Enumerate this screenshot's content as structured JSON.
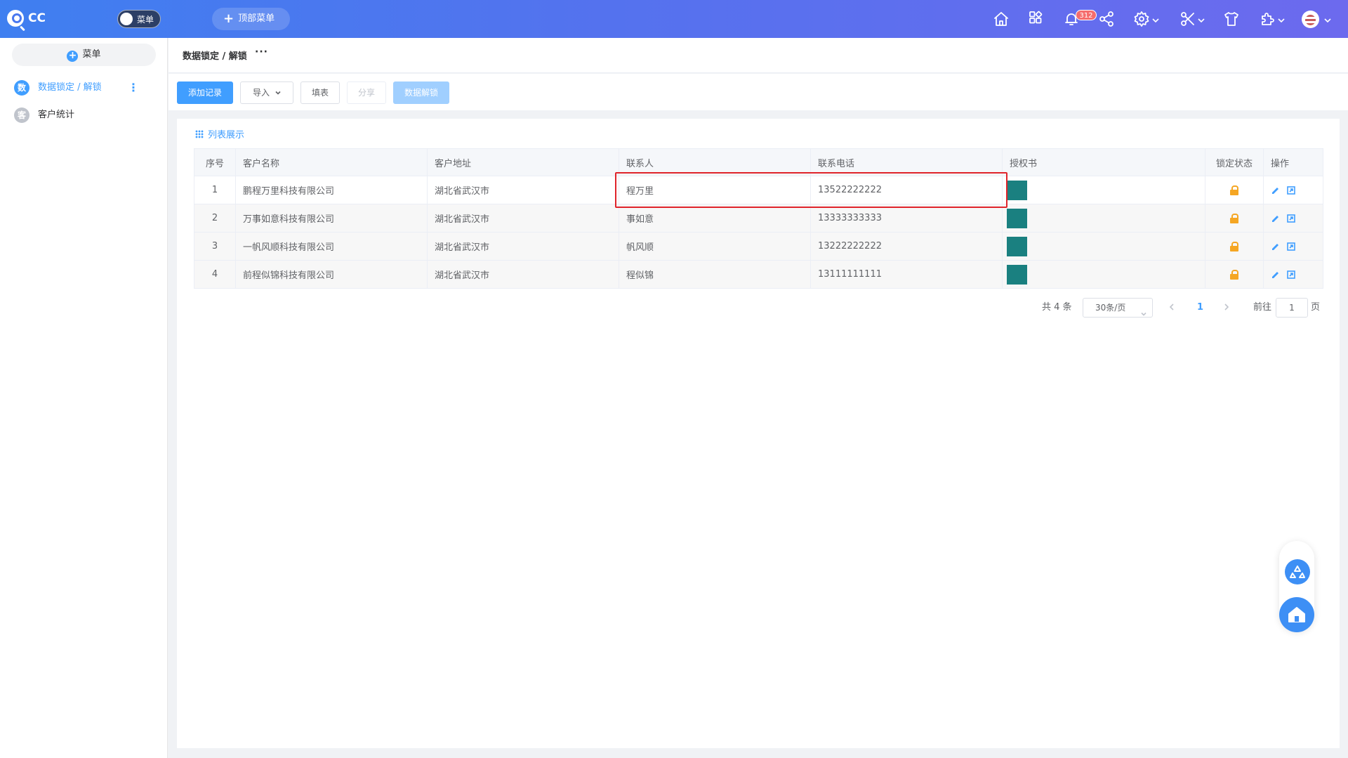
{
  "app": {
    "title": "CC"
  },
  "topbar": {
    "menu_toggle_label": "菜单",
    "top_menu_label": "顶部菜单",
    "notification_count": "312",
    "icons": [
      "home-icon",
      "apps-icon",
      "bell-icon",
      "share-icon",
      "gear-icon",
      "scissors-icon",
      "shirt-icon",
      "plugin-icon",
      "avatar"
    ]
  },
  "sidebar": {
    "menu_button_label": "菜单",
    "items": [
      {
        "badge": "数",
        "label": "数据锁定 / 解锁",
        "active": true,
        "badge_color": "#409eff"
      },
      {
        "badge": "客",
        "label": "客户统计",
        "active": false,
        "badge_color": "#c0c4cc"
      }
    ]
  },
  "breadcrumb": {
    "current": "数据锁定 / 解锁",
    "more": "···"
  },
  "toolbar": {
    "add": "添加记录",
    "import": "导入",
    "fill": "填表",
    "share": "分享",
    "unlock": "数据解锁"
  },
  "list": {
    "title": "列表展示",
    "columns": [
      "序号",
      "客户名称",
      "客户地址",
      "联系人",
      "联系电话",
      "授权书",
      "锁定状态",
      "操作"
    ],
    "rows": [
      {
        "no": "1",
        "name": "鹏程万里科技有限公司",
        "address": "湖北省武汉市",
        "contact": "程万里",
        "phone": "13522222222",
        "locked": true
      },
      {
        "no": "2",
        "name": "万事如意科技有限公司",
        "address": "湖北省武汉市",
        "contact": "事如意",
        "phone": "13333333333",
        "locked": true
      },
      {
        "no": "3",
        "name": "一帆风顺科技有限公司",
        "address": "湖北省武汉市",
        "contact": "帆风顺",
        "phone": "13222222222",
        "locked": true
      },
      {
        "no": "4",
        "name": "前程似锦科技有限公司",
        "address": "湖北省武汉市",
        "contact": "程似锦",
        "phone": "13111111111",
        "locked": true
      }
    ],
    "auth_color": "#1a8080",
    "lock_color": "#f5a623"
  },
  "pagination": {
    "total": "共 4 条",
    "page_size": "30条/页",
    "current_page": "1",
    "goto_prefix": "前往",
    "goto_value": "1",
    "goto_suffix": "页"
  },
  "colors": {
    "accent": "#409eff",
    "highlight_border": "#e0242b"
  }
}
